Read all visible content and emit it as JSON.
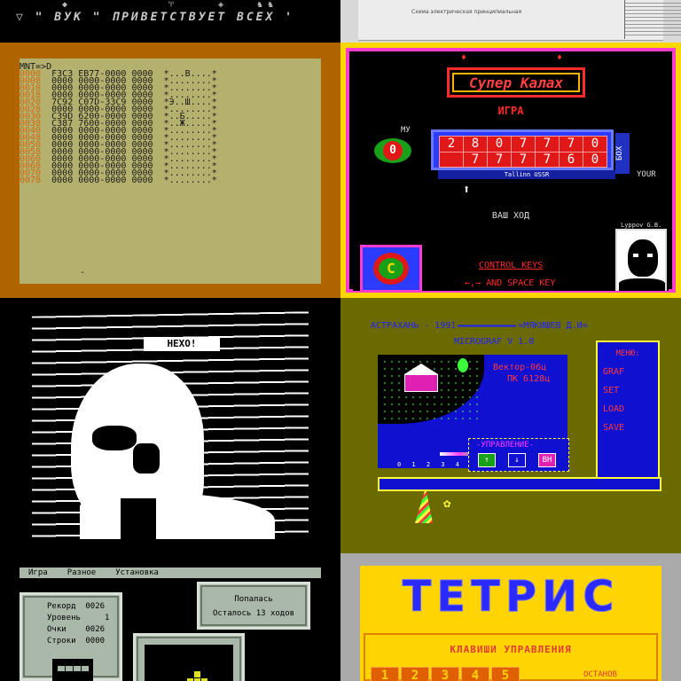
{
  "banner": {
    "text": "▽   \" ВУК \"  ПРИВЕТСТВУЕТ ВСЕХ '"
  },
  "paper": {
    "text": "Схема электрическая принципиальная"
  },
  "monitor": {
    "prompt": "MNT=>D",
    "rows": [
      {
        "addr": "0000",
        "hex": "F3C3 EB77-0000 0000",
        "ascii": "*...B....*"
      },
      {
        "addr": "0008",
        "hex": "0000 0000-0000 0000",
        "ascii": "*........*"
      },
      {
        "addr": "0010",
        "hex": "0000 0000-0000 0000",
        "ascii": "*........*"
      },
      {
        "addr": "0018",
        "hex": "0000 0000-0000 0000",
        "ascii": "*........*"
      },
      {
        "addr": "0020",
        "hex": "7C92 C07D-33C9 0000",
        "ascii": "*Э..Ш....*"
      },
      {
        "addr": "0028",
        "hex": "0000 0000-0000 0000",
        "ascii": "*........*"
      },
      {
        "addr": "0030",
        "hex": "C39D 6200-0000 0000",
        "ascii": "*..Б.....*"
      },
      {
        "addr": "0038",
        "hex": "C387 7600-0000 0000",
        "ascii": "*..Ж.....*"
      },
      {
        "addr": "0040",
        "hex": "0000 0000-0000 0000",
        "ascii": "*........*"
      },
      {
        "addr": "0048",
        "hex": "0000 0000-0000 0000",
        "ascii": "*........*"
      },
      {
        "addr": "0050",
        "hex": "0000 0000-0000 0000",
        "ascii": "*........*"
      },
      {
        "addr": "0058",
        "hex": "0000 0000-0000 0000",
        "ascii": "*........*"
      },
      {
        "addr": "0060",
        "hex": "0000 0000-0000 0000",
        "ascii": "*........*"
      },
      {
        "addr": "0068",
        "hex": "0000 0000-0000 0000",
        "ascii": "*........*"
      },
      {
        "addr": "0070",
        "hex": "0000 0000-0000 0000",
        "ascii": "*........*"
      },
      {
        "addr": "0078",
        "hex": "0000 0000-0000 0000",
        "ascii": "*........*"
      }
    ],
    "cursor": "-"
  },
  "kalah": {
    "title": "Супер Калах",
    "subtitle": "ИГРА",
    "my_label": "МУ",
    "my_score": "0",
    "board_top": [
      "2",
      "8",
      "0",
      "7",
      "7",
      "7",
      "0"
    ],
    "board_bottom": [
      "",
      "7",
      "7",
      "7",
      "7",
      "6",
      "0"
    ],
    "board_side": "БОХ",
    "board_base": "Tallinn USSR",
    "your_label": "YOUR",
    "your_move": "ВАШ ХОД",
    "author": "Lyppov G.B.",
    "logo_letter": "C",
    "control_keys": "CONTROL KEYS",
    "arrows_keys": "←,→ AND SPACE KEY"
  },
  "portrait": {
    "tag": "НЕХО!"
  },
  "micrograf": {
    "header": "АСТРАХАНЬ - 1991",
    "author": "=МЯКИШЕВ Д.И=",
    "title": "MICROGRAF V 1.0",
    "vektor_line1": "Вектор-06ц",
    "vektor_line2": "ПК 6128ц",
    "scale": "0 1 2 3 4 5 6",
    "control_label": "-УПРАВЛЕНИЕ-",
    "btn_up": "↑",
    "btn_down": "↓",
    "btn_exit": "ВН",
    "menu_title": "МЕНЮ:",
    "menu_items": [
      "GRAF",
      "SET",
      "LOAD",
      "SAVE"
    ],
    "colors": {
      "bg": "#6a6a00",
      "accent": "#1010d0",
      "frame": "#ffff3a"
    }
  },
  "tetris_game": {
    "menu": [
      "Игра",
      "Разное",
      "Установка"
    ],
    "record_label": "Рекорд",
    "record_value": "0026",
    "level_label": "Уровень",
    "level_value": "1",
    "score_label": "Очки",
    "score_value": "0026",
    "lines_label": "Строки",
    "lines_value": "0000",
    "msg_line1": "Попалась",
    "msg_line2": "Осталось  13  ходов"
  },
  "tetris_title": {
    "logo": "ТЕТРИС",
    "subtitle": "КЛАВИШИ УПРАВЛЕНИЯ",
    "keys": [
      "1",
      "2",
      "3",
      "4",
      "5"
    ],
    "stop_label": "ОСТАНОВ"
  }
}
